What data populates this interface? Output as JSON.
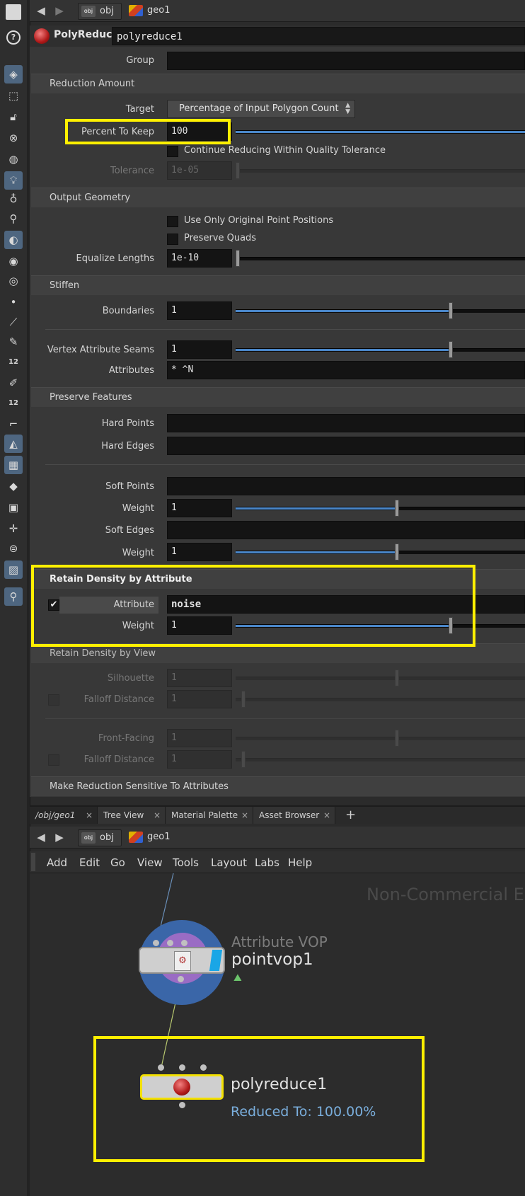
{
  "path_bar": {
    "back_icon": "arrow-left-icon",
    "forward_icon": "arrow-right-icon",
    "crumbs": [
      "obj",
      "geo1"
    ]
  },
  "node": {
    "type_label": "PolyReduce",
    "name": "polyreduce1",
    "icon": "polyreduce-sphere-icon",
    "icon_color": "#c82020"
  },
  "params": {
    "group": {
      "label": "Group",
      "value": ""
    },
    "reduction": {
      "folder": "Reduction Amount",
      "target": {
        "label": "Target",
        "value": "Percentage of Input Polygon Count"
      },
      "percent": {
        "label": "Percent To Keep",
        "value": "100"
      },
      "continue_reducing": {
        "label": "Continue Reducing Within Quality Tolerance",
        "checked": false
      },
      "tolerance": {
        "label": "Tolerance",
        "value": "1e-05"
      }
    },
    "output": {
      "folder": "Output Geometry",
      "original_positions": {
        "label": "Use Only Original Point Positions",
        "checked": false
      },
      "preserve_quads": {
        "label": "Preserve Quads",
        "checked": false
      },
      "equalize": {
        "label": "Equalize Lengths",
        "value": "1e-10"
      }
    },
    "stiffen": {
      "folder": "Stiffen",
      "boundaries": {
        "label": "Boundaries",
        "value": "1"
      },
      "seams": {
        "label": "Vertex Attribute Seams",
        "value": "1"
      },
      "attributes": {
        "label": "Attributes",
        "value": "* ^N"
      }
    },
    "preserve": {
      "folder": "Preserve Features",
      "hard_points": {
        "label": "Hard Points",
        "value": ""
      },
      "hard_edges": {
        "label": "Hard Edges",
        "value": ""
      },
      "soft_points": {
        "label": "Soft Points",
        "value": ""
      },
      "soft_points_weight": {
        "label": "Weight",
        "value": "1"
      },
      "soft_edges": {
        "label": "Soft Edges",
        "value": ""
      },
      "soft_edges_weight": {
        "label": "Weight",
        "value": "1"
      }
    },
    "retain_attr": {
      "folder": "Retain Density by Attribute",
      "attribute": {
        "label": "Attribute",
        "value": "noise",
        "checked": true
      },
      "weight": {
        "label": "Weight",
        "value": "1"
      }
    },
    "retain_view": {
      "folder": "Retain Density by View",
      "silhouette": {
        "label": "Silhouette",
        "value": "1"
      },
      "falloff1": {
        "label": "Falloff Distance",
        "value": "1"
      },
      "front_facing": {
        "label": "Front-Facing",
        "value": "1"
      },
      "falloff2": {
        "label": "Falloff Distance",
        "value": "1"
      }
    },
    "sensitive": {
      "folder": "Make Reduction Sensitive To Attributes"
    }
  },
  "tabs": [
    {
      "label": "/obj/geo1"
    },
    {
      "label": "Tree View"
    },
    {
      "label": "Material Palette"
    },
    {
      "label": "Asset Browser"
    }
  ],
  "tab_add": "+",
  "tab_close": "×",
  "network_path": {
    "crumbs": [
      "obj",
      "geo1"
    ]
  },
  "menu": [
    "Add",
    "Edit",
    "Go",
    "View",
    "Tools",
    "Layout",
    "Labs",
    "Help"
  ],
  "network": {
    "watermark": "Non-Commercial Ec",
    "vop_node": {
      "type_label": "Attribute VOP",
      "name": "pointvop1"
    },
    "reduce_node": {
      "name": "polyreduce1",
      "status": "Reduced To: 100.00%"
    }
  },
  "colors": {
    "highlight": "#fff000",
    "accent": "#4a86c8",
    "status_text": "#7aaedc"
  }
}
